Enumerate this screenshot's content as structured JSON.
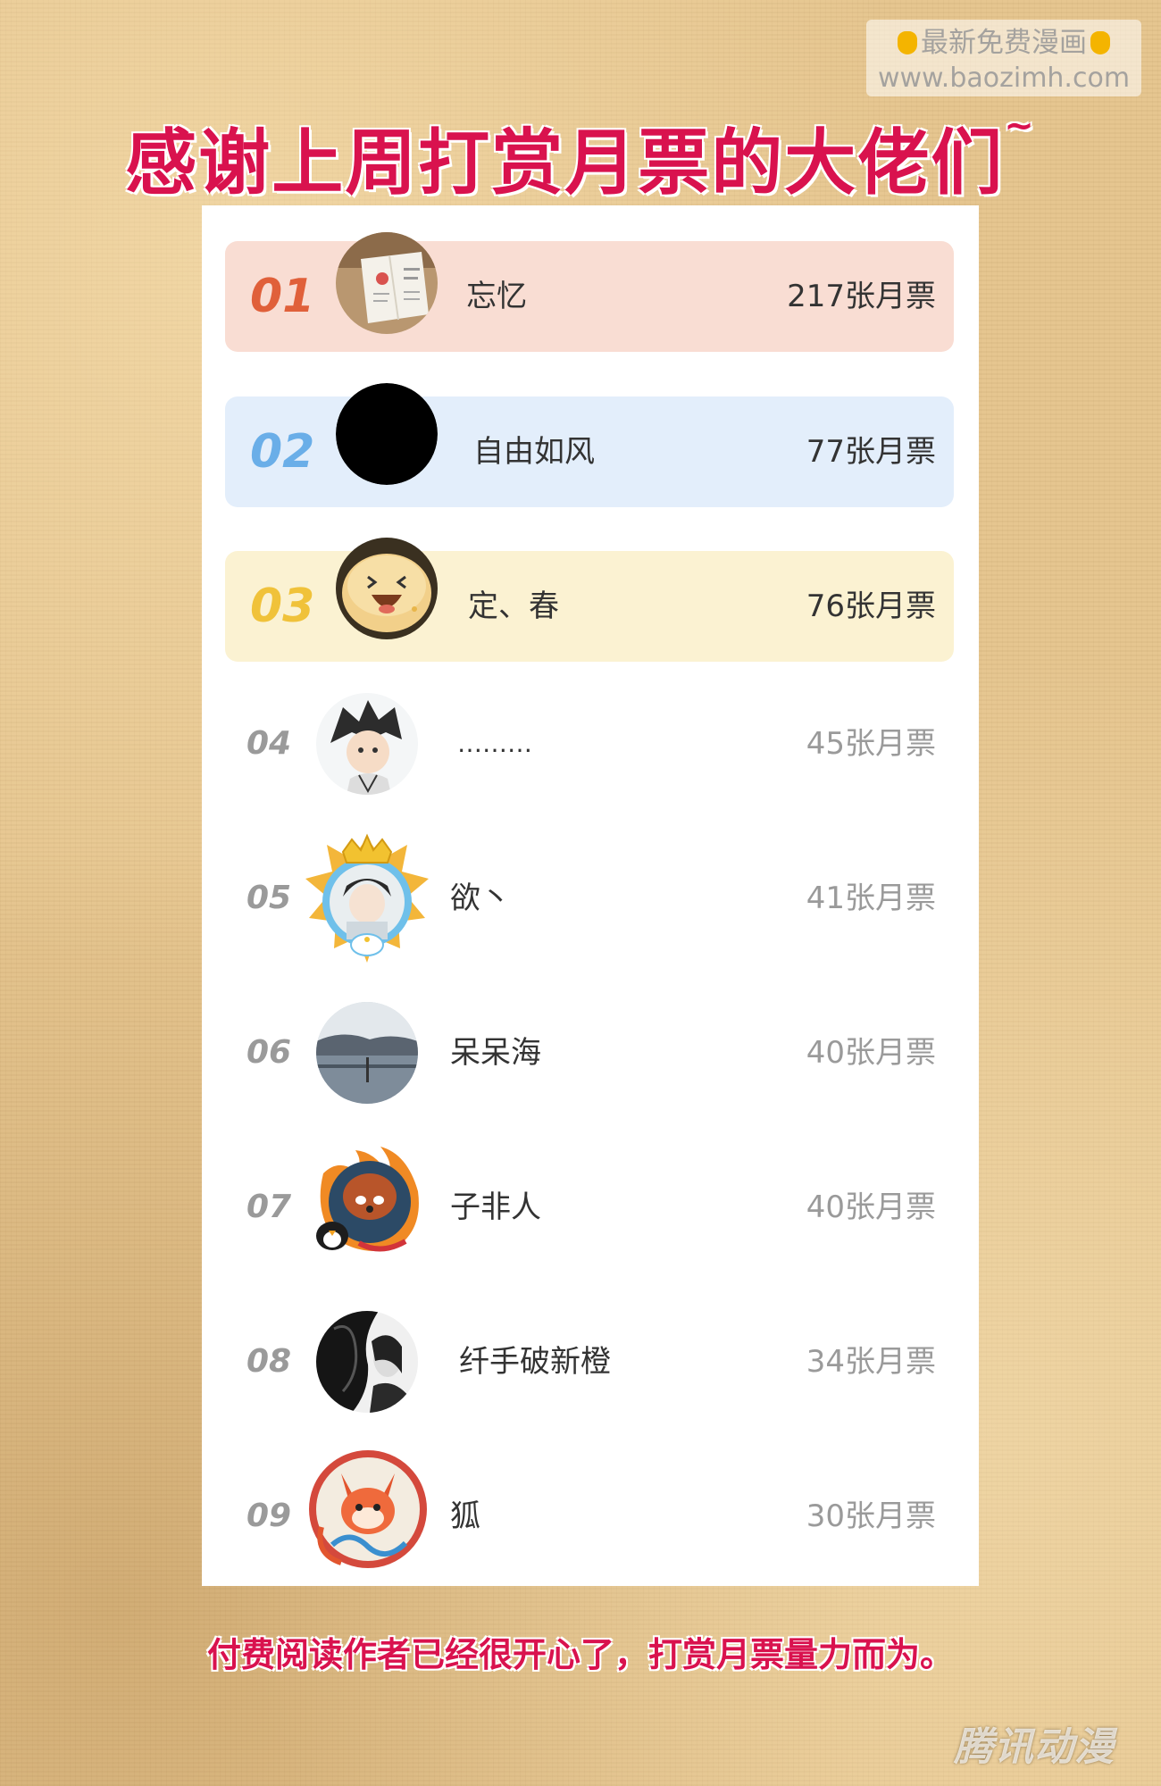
{
  "watermark": {
    "line1": "最新免费漫画",
    "line2": "www.baozimh.com"
  },
  "title": "感谢上周打赏月票的大佬们",
  "title_tilde": "~",
  "rankings": [
    {
      "rank": "01",
      "name": "忘忆",
      "votes": "217张月票"
    },
    {
      "rank": "02",
      "name": "自由如风",
      "votes": "77张月票"
    },
    {
      "rank": "03",
      "name": "定、春",
      "votes": "76张月票"
    },
    {
      "rank": "04",
      "name": "………",
      "votes": "45张月票"
    },
    {
      "rank": "05",
      "name": "欲丶",
      "votes": "41张月票"
    },
    {
      "rank": "06",
      "name": "呆呆海",
      "votes": "40张月票"
    },
    {
      "rank": "07",
      "name": "子非人",
      "votes": "40张月票"
    },
    {
      "rank": "08",
      "name": "纤手破新橙",
      "votes": "34张月票"
    },
    {
      "rank": "09",
      "name": "狐",
      "votes": "30张月票"
    }
  ],
  "footer_note": "付费阅读作者已经很开心了，打赏月票量力而为。",
  "logo": "腾讯动漫",
  "colors": {
    "accent": "#d9124e",
    "rank1_bg": "#f9ddd3",
    "rank1_num": "#e0603a",
    "rank2_bg": "#e3eefb",
    "rank2_num": "#6aaee8",
    "rank3_bg": "#fbf2d2",
    "rank3_num": "#f0c23a",
    "muted": "#9a9a9a"
  }
}
